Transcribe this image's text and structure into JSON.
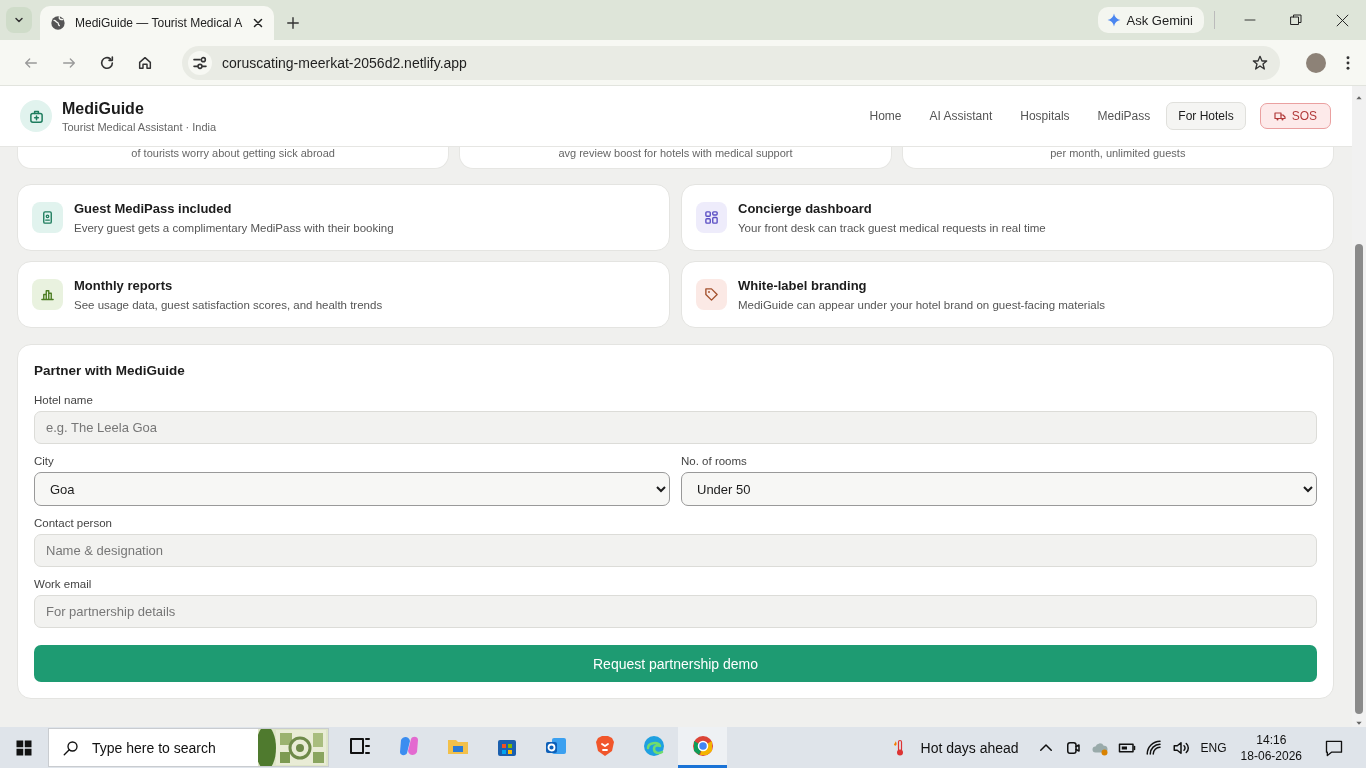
{
  "browser": {
    "tabs": [
      {
        "title": "MediGuide — Tourist Medical A",
        "selected": true
      }
    ],
    "url": "coruscating-meerkat-2056d2.netlify.app",
    "gemini": "Ask Gemini"
  },
  "header": {
    "brand": "MediGuide",
    "subtitle": "Tourist Medical Assistant · India",
    "nav": [
      {
        "label": "Home",
        "selected": false
      },
      {
        "label": "AI Assistant",
        "selected": false
      },
      {
        "label": "Hospitals",
        "selected": false
      },
      {
        "label": "MediPass",
        "selected": false
      },
      {
        "label": "For Hotels",
        "selected": true
      }
    ],
    "sos": "SOS"
  },
  "stats": [
    {
      "caption": "of tourists worry about getting sick abroad"
    },
    {
      "caption": "avg review boost for hotels with medical support"
    },
    {
      "caption": "per month, unlimited guests"
    }
  ],
  "features": [
    {
      "kind": "pass",
      "color": "#e1f3ee",
      "title": "Guest MediPass included",
      "description": "Every guest gets a complimentary MediPass with their booking"
    },
    {
      "kind": "dashboard",
      "color": "#eeecfb",
      "title": "Concierge dashboard",
      "description": "Your front desk can track guest medical requests in real time"
    },
    {
      "kind": "chart",
      "color": "#e9f2df",
      "title": "Monthly reports",
      "description": "See usage data, guest satisfaction scores, and health trends"
    },
    {
      "kind": "tag",
      "color": "#fbe9e5",
      "title": "White-label branding",
      "description": "MediGuide can appear under your hotel brand on guest-facing materials"
    }
  ],
  "form": {
    "title": "Partner with MediGuide",
    "rows": [
      [
        {
          "kind": "text",
          "label": "Hotel name",
          "placeholder": "e.g. The Leela Goa"
        }
      ],
      [
        {
          "kind": "select",
          "label": "City",
          "value": "Goa"
        },
        {
          "kind": "select",
          "label": "No. of rooms",
          "value": "Under 50"
        }
      ],
      [
        {
          "kind": "text",
          "label": "Contact person",
          "placeholder": "Name & designation"
        }
      ],
      [
        {
          "kind": "text",
          "label": "Work email",
          "placeholder": "For partnership details"
        }
      ]
    ],
    "button": "Request partnership demo"
  },
  "taskbar": {
    "search": "Type here to search",
    "apps": [
      {
        "kind": "taskview",
        "active": false
      },
      {
        "kind": "copilot",
        "active": false
      },
      {
        "kind": "folder",
        "active": false
      },
      {
        "kind": "store",
        "active": false
      },
      {
        "kind": "mail",
        "active": false
      },
      {
        "kind": "brave",
        "active": false
      },
      {
        "kind": "edge",
        "active": false
      },
      {
        "kind": "chrome",
        "active": true
      }
    ],
    "weather": "Hot days ahead",
    "lang": "ENG",
    "time": "14:16",
    "date": "18-06-2026"
  }
}
